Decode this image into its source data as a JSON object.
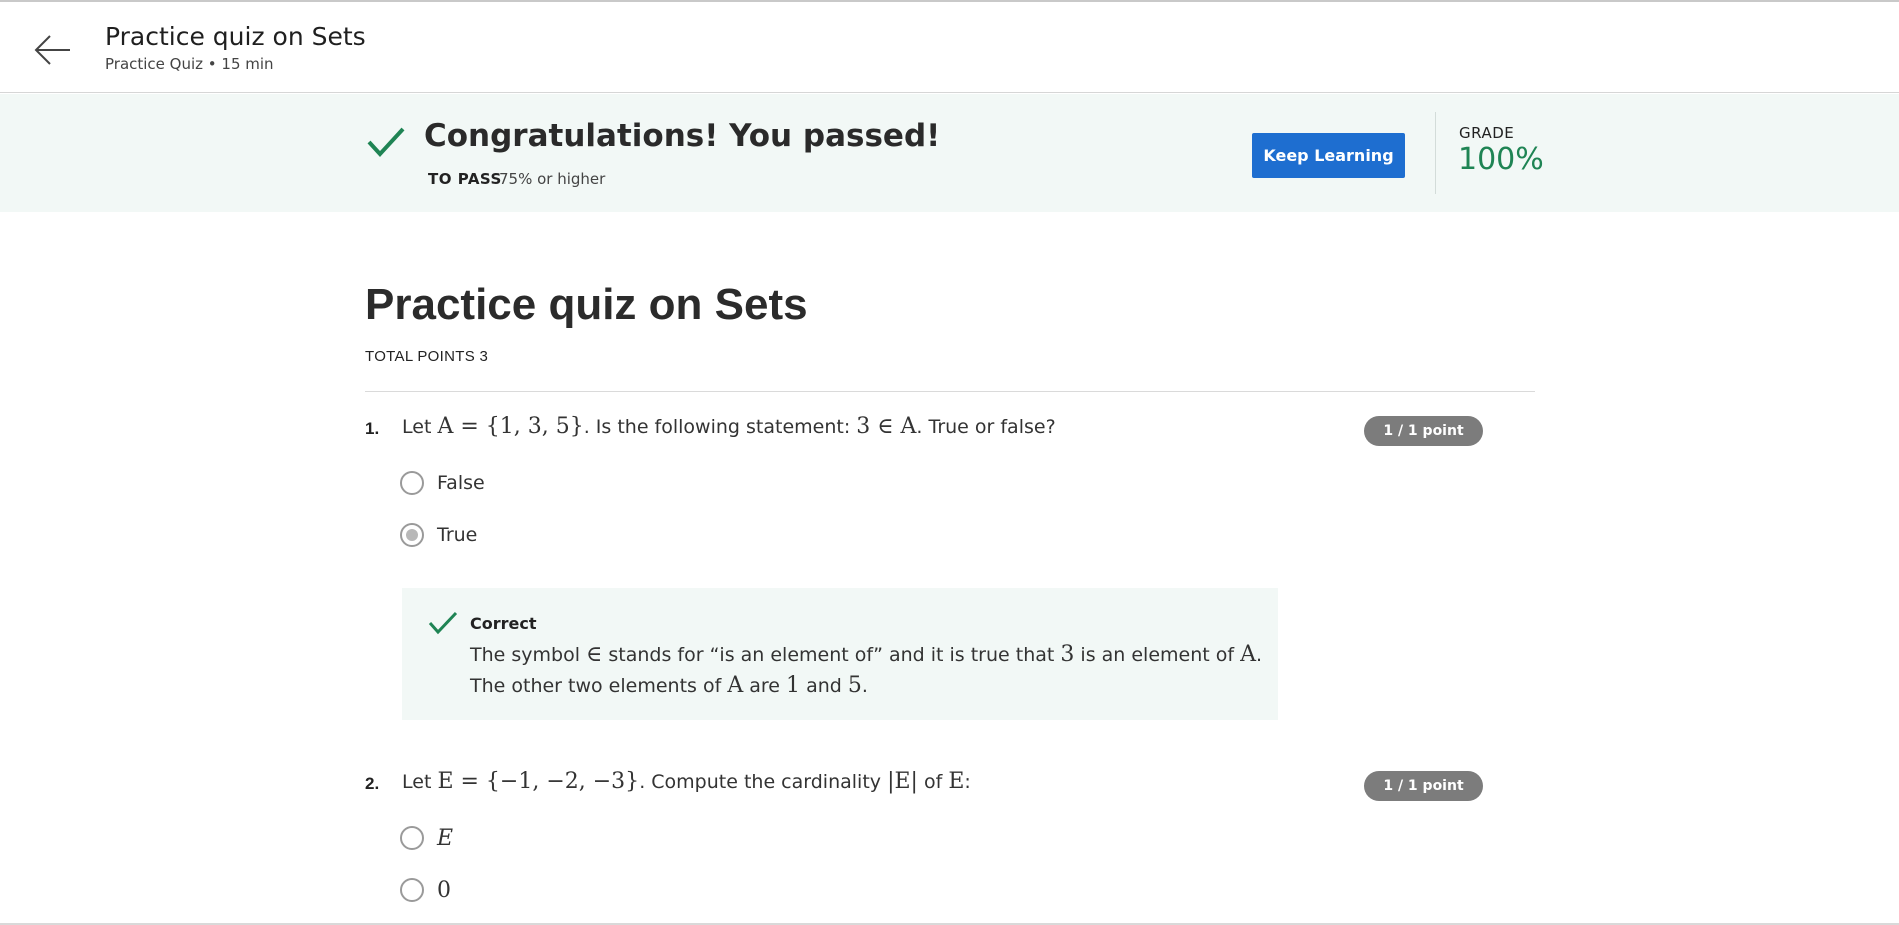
{
  "header": {
    "title": "Practice quiz on Sets",
    "subtitle": "Practice Quiz • 15 min"
  },
  "banner": {
    "title": "Congratulations! You passed!",
    "to_pass_label": "TO PASS",
    "to_pass_value": "75% or higher",
    "button_label": "Keep Learning",
    "grade_label": "GRADE",
    "grade_value": "100%"
  },
  "quiz": {
    "title": "Practice quiz on Sets",
    "total_points": "TOTAL POINTS 3",
    "questions": [
      {
        "number": "1.",
        "text_parts": [
          "Let ",
          "A = {1, 3, 5}",
          ". Is the following statement: ",
          "3 ∈ A",
          ". True or false?"
        ],
        "points": "1 / 1 point",
        "options": [
          {
            "label": "False",
            "selected": false
          },
          {
            "label": "True",
            "selected": true
          }
        ],
        "feedback": {
          "label": "Correct",
          "line1_parts": [
            "The symbol ",
            "∈",
            " stands for “is an element of” and it is true that ",
            "3",
            " is an element of ",
            "A",
            "."
          ],
          "line2_parts": [
            "The other two elements of ",
            "A",
            " are ",
            "1",
            " and ",
            "5",
            "."
          ]
        }
      },
      {
        "number": "2.",
        "text_parts": [
          "Let ",
          "E = {−1, −2, −3}",
          ". Compute the cardinality ",
          "|E|",
          " of ",
          "E",
          ":"
        ],
        "points": "1 / 1 point",
        "options": [
          {
            "label": "E",
            "selected": false
          },
          {
            "label": "0",
            "selected": false
          }
        ]
      }
    ]
  },
  "icons": {
    "back": "arrow-left-icon",
    "check": "checkmark-icon"
  },
  "colors": {
    "accent_blue": "#1e6ed0",
    "success_green": "#1f8454",
    "banner_bg": "#f2f8f6",
    "badge_gray": "#7c7c7c"
  }
}
